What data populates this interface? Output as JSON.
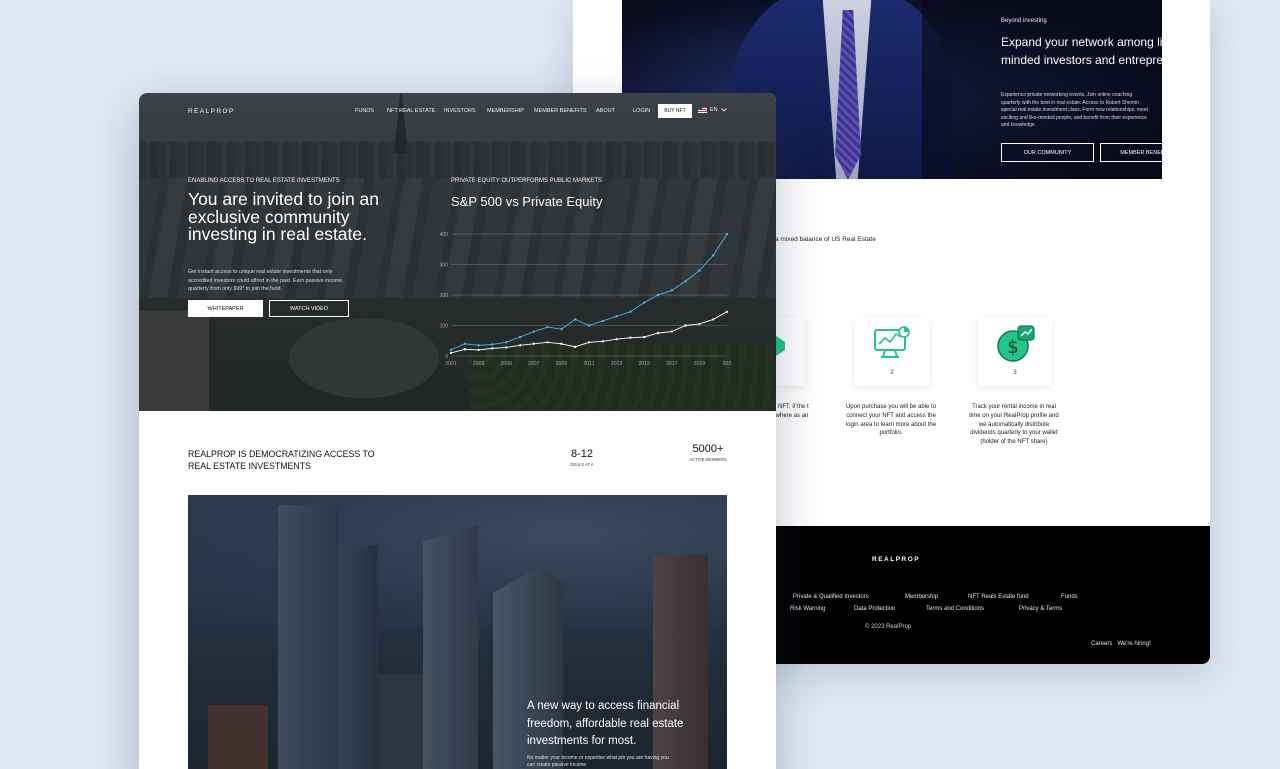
{
  "back": {
    "eyebrow": "Beyond investing",
    "title": "Expand your network among like -minded investors and entrepreneurs",
    "text": "Experience private networking events. Join online coaching quarterly with the best in real estate. Access to Robert Shemin special real estate investment class. Form new relationships, meet exciting and like-minded people, and benefit from their experience and knowledge.",
    "btn_community": "OUR COMMUNITY",
    "btn_benefits": "MEMBER BENEFITS",
    "mixed": "a mixed balance of US Real Estate",
    "steps": [
      {
        "num": "2",
        "icon": "monitor-chart-icon"
      },
      {
        "num": "3",
        "icon": "dollar-growth-icon"
      }
    ],
    "step_desc_partial": "fund and NFT, if the t you can where as an iness.",
    "step_desc_2": "Upon purchase you will be able to connect your NFT and access the login area to learn more about the portfolio.",
    "step_desc_3": "Track your rental income in real time on your RealProp profile and we automatically distribute dividends quarterly to your wallet (holder of the NFT share)",
    "footer": {
      "logo": "REALPROP",
      "links_row1": [
        "Private & Qualified Investors",
        "Membership",
        "NFT Reals Estate fund",
        "Funds"
      ],
      "links_row2": [
        "Risk Warning",
        "Data Protection",
        "Terms and Conditions",
        "Privacy & Terms"
      ],
      "copyright": "© 2023 RealProp",
      "careers": "Careers",
      "hiring": "We're hiring!"
    }
  },
  "nav": {
    "logo": "REALPROP",
    "items": [
      "FUNDS",
      "NFT REAL ESTATE",
      "INVESTORS",
      "MEMBERSHIP",
      "MEMBER BENEFITS",
      "ABOUT"
    ],
    "login": "LOGIN",
    "buy": "BUY NFT",
    "lang": "EN"
  },
  "hero": {
    "eyebrow": "ENABLING ACCESS TO REAL ESTATE INVESTMENTS",
    "title": "You are invited to join an exclusive community investing in real estate.",
    "text": "Get instant access to unique real estate investments that only accredited investors could afford in the past. Earn passive income quarterly from only $99* to join the fund.",
    "btn_whitepaper": "WHITEPAPER",
    "btn_video": "WATCH VIDEO"
  },
  "chart_data": {
    "type": "line",
    "eyebrow": "PRIVATE EQUITY OUTPERFORMS PUBLIC MARKETS",
    "title": "S&P 500 vs Private Equity",
    "x_labels": [
      "2001",
      "2003",
      "2005",
      "2007",
      "2009",
      "2011",
      "2013",
      "2015",
      "2017",
      "2019",
      "202"
    ],
    "x": [
      2001,
      2002,
      2003,
      2004,
      2005,
      2006,
      2007,
      2008,
      2009,
      2010,
      2011,
      2012,
      2013,
      2014,
      2015,
      2016,
      2017,
      2018,
      2019,
      2020,
      2021
    ],
    "y_labels": [
      "400",
      "300",
      "200",
      "100",
      "0"
    ],
    "ylim": [
      0,
      400
    ],
    "series": [
      {
        "color": "#4fb3e8",
        "values": [
          20,
          40,
          35,
          38,
          45,
          62,
          80,
          95,
          88,
          120,
          100,
          115,
          130,
          145,
          175,
          200,
          215,
          245,
          280,
          330,
          400
        ]
      },
      {
        "color": "#ffffff",
        "values": [
          10,
          22,
          20,
          25,
          28,
          35,
          40,
          45,
          40,
          30,
          45,
          48,
          55,
          60,
          62,
          75,
          80,
          100,
          105,
          120,
          145
        ]
      }
    ]
  },
  "stats": {
    "title": "REALPROP IS DEMOCRATIZING ACCESS TO REAL ESTATE INVESTMENTS",
    "s1_value": "8-12",
    "s1_label": "DEALS AT A",
    "s2_value": "5000+",
    "s2_label": "ACTIVE MEMBERS"
  },
  "city": {
    "title": "A new way to access financial freedom, affordable real estate investments for most.",
    "text": "No matter your income or expertise what job you are having you can create passive income"
  }
}
